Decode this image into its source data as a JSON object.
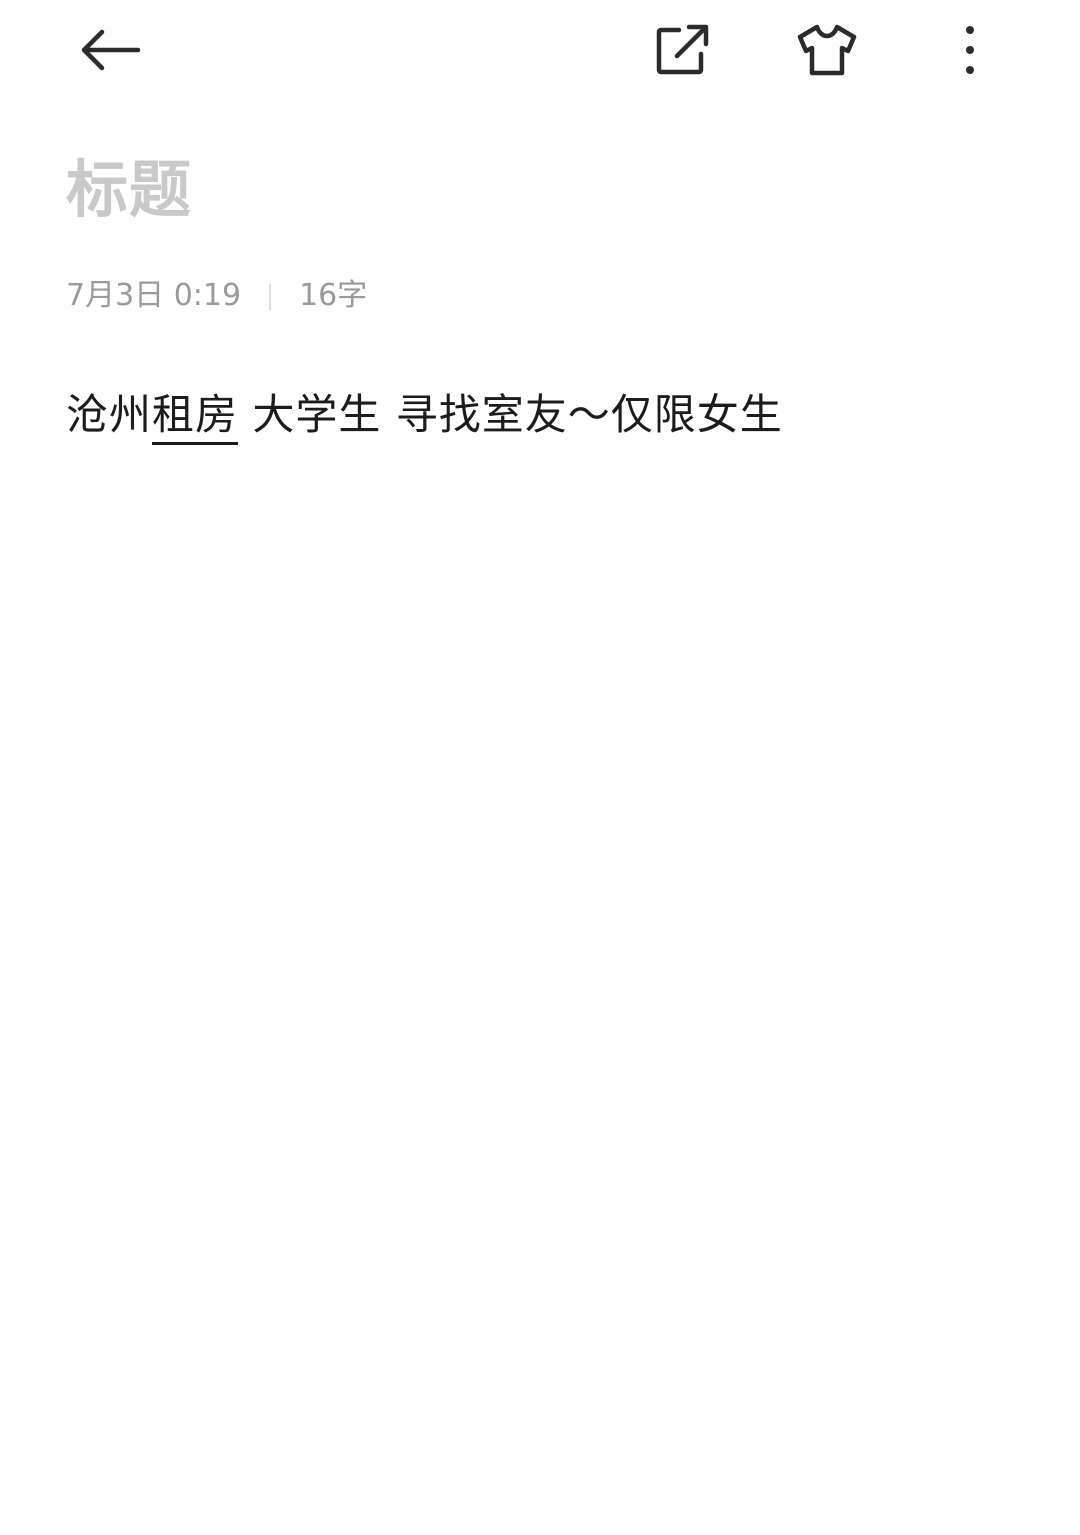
{
  "toolbar": {
    "back_icon": "arrow-left-icon",
    "share_icon": "share-external-icon",
    "theme_icon": "tshirt-icon",
    "more_icon": "more-vertical-icon"
  },
  "note": {
    "title_placeholder": "标题",
    "date": "7月3日 0:19",
    "word_count": "16字",
    "body_part1": "沧州",
    "body_underlined": "租房",
    "body_part2": " 大学生 寻找室友～仅限女生"
  },
  "colors": {
    "text": "#1c1c1c",
    "placeholder": "#c9c9c9",
    "meta": "#9a9a9a",
    "icon": "#2b2b2b",
    "background": "#ffffff"
  }
}
